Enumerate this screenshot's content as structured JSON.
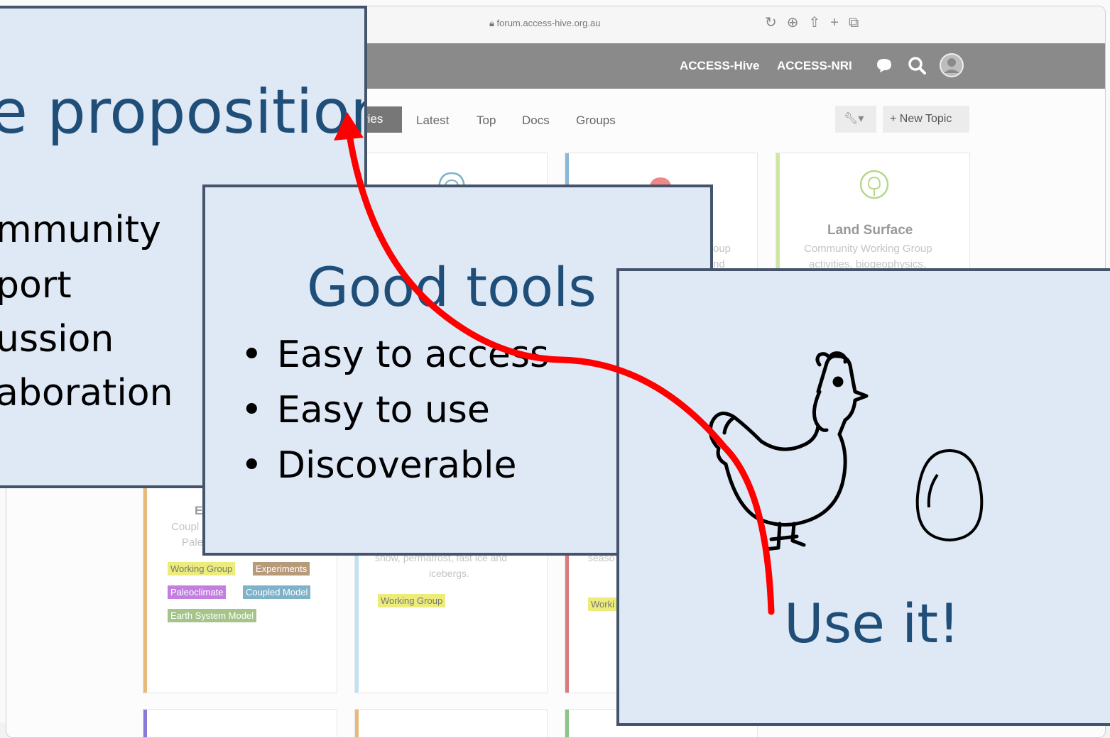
{
  "browser": {
    "url": "forum.access-hive.org.au"
  },
  "forum": {
    "header_links": [
      "ACCESS-Hive",
      "ACCESS-NRI"
    ],
    "nav": {
      "active_partial": "ries",
      "items": [
        "Latest",
        "Top",
        "Docs",
        "Groups"
      ]
    },
    "new_topic": "+ New Topic",
    "cards": {
      "land": {
        "title": "Land Surface",
        "desc1": "Community Working Group",
        "desc2": "activities, biogeophysics,"
      },
      "partial_middle": {
        "line1": "oup",
        "line2": "nd"
      },
      "left": {
        "title_partial": "E",
        "desc1": "Coupl",
        "desc2": "Pale",
        "tags": [
          "Working Group",
          "Experiments",
          "Paleoclimate",
          "Coupled Model",
          "Earth System Model"
        ]
      },
      "center": {
        "desc1": "snow, permafrost, fast ice and",
        "desc2": "icebergs.",
        "tag": "Working Group"
      },
      "right": {
        "desc1": "seaso",
        "tag": "Worki"
      }
    }
  },
  "slides": {
    "value": {
      "title": "e proposition",
      "bullets": [
        "mmunity",
        "port",
        "ussion",
        "aboration"
      ]
    },
    "tools": {
      "title": "Good tools",
      "bullets": [
        "Easy to access",
        "Easy to use",
        "Discoverable"
      ]
    },
    "use": {
      "title": "Use it!",
      "icons": [
        "chicken-icon",
        "egg-icon"
      ]
    }
  },
  "colors": {
    "slide_bg": "#dfe8f5",
    "slide_border": "#44546a",
    "title_blue": "#1f4e79",
    "arrow_red": "#ff0000",
    "tag_yellow": "#ecec7a",
    "tag_brown": "#b79a7a",
    "tag_purple": "#c27fe0",
    "tag_blue": "#7fb2c9",
    "tag_green": "#a5c48a"
  }
}
